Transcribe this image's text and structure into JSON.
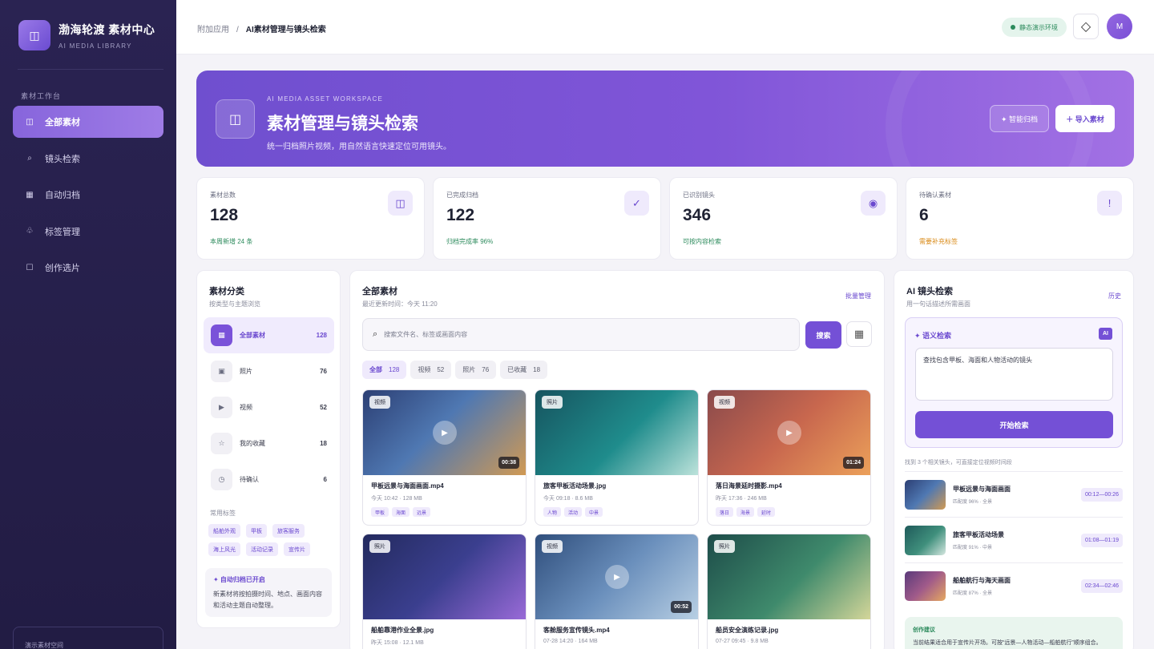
{
  "brand": {
    "title": "渤海轮渡 素材中心",
    "subtitle": "AI MEDIA LIBRARY",
    "logo_icon": "columns-icon"
  },
  "sidebar": {
    "section": "素材工作台",
    "items": [
      {
        "label": "全部素材",
        "icon": "columns-icon",
        "active": true
      },
      {
        "label": "镜头检索",
        "icon": "search-icon"
      },
      {
        "label": "自动归档",
        "icon": "archive-icon"
      },
      {
        "label": "标签管理",
        "icon": "tag-icon"
      },
      {
        "label": "创作选片",
        "icon": "square-icon"
      }
    ],
    "bottom_label": "演示素材空间"
  },
  "topbar": {
    "crumb_parent": "附加应用",
    "crumb_sep": "/",
    "crumb_current": "AI素材管理与镜头检索",
    "env_badge": "静态演示环境",
    "avatar": "M"
  },
  "hero": {
    "eyebrow": "AI MEDIA ASSET WORKSPACE",
    "title": "素材管理与镜头检索",
    "desc": "统一归档照片视频，用自然语言快速定位可用镜头。",
    "btn_smart": "✦ 智能归档",
    "btn_import": "＋ 导入素材"
  },
  "stats": [
    {
      "label": "素材总数",
      "value": "128",
      "note": "本周新增 24 条",
      "icon": "columns-icon",
      "glyph": "◫"
    },
    {
      "label": "已完成归档",
      "value": "122",
      "note": "归档完成率 96%",
      "icon": "check-icon",
      "glyph": "✓"
    },
    {
      "label": "已识别镜头",
      "value": "346",
      "note": "可按内容检索",
      "icon": "target-icon",
      "glyph": "◉"
    },
    {
      "label": "待确认素材",
      "value": "6",
      "note": "需要补充标签",
      "icon": "alert-icon",
      "glyph": "!"
    }
  ],
  "categories": {
    "title": "素材分类",
    "subtitle": "按类型与主题浏览",
    "items": [
      {
        "name": "全部素材",
        "count": "128",
        "glyph": "▦",
        "icon": "grid-icon"
      },
      {
        "name": "照片",
        "count": "76",
        "glyph": "▣",
        "icon": "photo-icon"
      },
      {
        "name": "视频",
        "count": "52",
        "glyph": "▶",
        "icon": "play-icon"
      },
      {
        "name": "我的收藏",
        "count": "18",
        "glyph": "☆",
        "icon": "star-icon"
      },
      {
        "name": "待确认",
        "count": "6",
        "glyph": "◷",
        "icon": "clock-icon"
      }
    ],
    "tags_title": "常用标签",
    "tags": [
      "船舶外观",
      "甲板",
      "旅客服务",
      "海上风光",
      "活动记录",
      "宣传片"
    ],
    "auto_title": "✦ 自动归档已开启",
    "auto_desc": "新素材将按拍摄时间、地点、画面内容和活动主题自动整理。"
  },
  "library": {
    "title": "全部素材",
    "updated": "最近更新时间：今天 11:20",
    "batch": "批量管理",
    "search_placeholder": "搜索文件名、标签或画面内容",
    "search_btn": "搜索",
    "filters": [
      {
        "label": "全部",
        "count": "128"
      },
      {
        "label": "视频",
        "count": "52"
      },
      {
        "label": "照片",
        "count": "76"
      },
      {
        "label": "已收藏",
        "count": "18"
      }
    ],
    "cards": [
      {
        "type": "视频",
        "name": "甲板远景与海面画面.mp4",
        "meta": "今天 10:42 · 128 MB",
        "duration": "00:38",
        "tags": [
          "甲板",
          "海面",
          "远景"
        ]
      },
      {
        "type": "照片",
        "name": "旅客甲板活动场景.jpg",
        "meta": "今天 09:18 · 8.6 MB",
        "duration": "",
        "tags": [
          "人物",
          "活动",
          "中景"
        ]
      },
      {
        "type": "视频",
        "name": "落日海景延时摄影.mp4",
        "meta": "昨天 17:36 · 246 MB",
        "duration": "01:24",
        "tags": [
          "落日",
          "海景",
          "延时"
        ]
      },
      {
        "type": "照片",
        "name": "船舶靠港作业全景.jpg",
        "meta": "昨天 15:08 · 12.1 MB",
        "duration": "",
        "tags": []
      },
      {
        "type": "视频",
        "name": "客舱服务宣传镜头.mp4",
        "meta": "07-28 14:20 · 164 MB",
        "duration": "00:52",
        "tags": []
      },
      {
        "type": "照片",
        "name": "船员安全演练记录.jpg",
        "meta": "07-27 09:45 · 9.8 MB",
        "duration": "",
        "tags": []
      }
    ]
  },
  "ai": {
    "title": "AI 镜头检索",
    "subtitle": "用一句话描述所需画面",
    "history": "历史",
    "box_title": "✦ 语义检索",
    "badge": "AI",
    "query": "查找包含甲板、海面和人物活动的镜头",
    "start_btn": "开始检索",
    "found": "找到 3 个相关镜头，可直接定位视频时间段",
    "results": [
      {
        "name": "甲板远景与海面画面",
        "meta": "匹配度 96% · 全景",
        "time": "00:12—00:26"
      },
      {
        "name": "旅客甲板活动场景",
        "meta": "匹配度 91% · 中景",
        "time": "01:08—01:19"
      },
      {
        "name": "船舶航行与海天画面",
        "meta": "匹配度 87% · 全景",
        "time": "02:34—02:46"
      }
    ],
    "tip_title": "创作建议",
    "tip_desc": "当前结果适合用于宣传片开场。可按“远景—人物活动—船舶航行”顺序组合。"
  }
}
